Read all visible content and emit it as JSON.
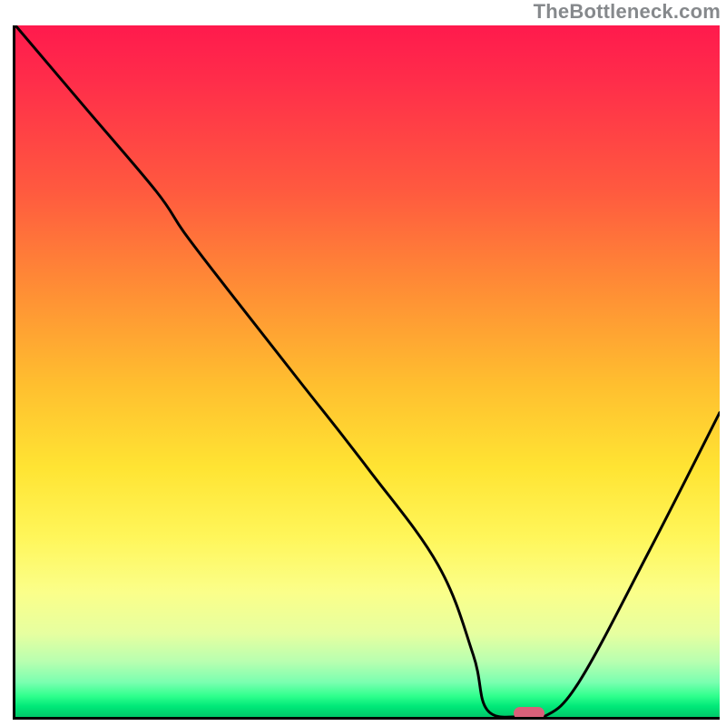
{
  "watermark": "TheBottleneck.com",
  "colors": {
    "axis": "#000000",
    "curve": "#000000",
    "marker": "#d9607a",
    "gradient_top": "#ff1a4d",
    "gradient_bottom": "#00c86a"
  },
  "chart_data": {
    "type": "line",
    "title": "",
    "xlabel": "",
    "ylabel": "",
    "xlim": [
      0,
      100
    ],
    "ylim": [
      0,
      100
    ],
    "grid": false,
    "legend": false,
    "series": [
      {
        "name": "curve",
        "x": [
          0,
          10,
          20,
          24,
          30,
          40,
          50,
          60,
          65,
          67,
          72,
          75,
          80,
          90,
          100
        ],
        "y": [
          100,
          88,
          76,
          70,
          62,
          49,
          36,
          22,
          9,
          1,
          0,
          0,
          5,
          24,
          44
        ]
      }
    ],
    "valley_marker": {
      "x": 73,
      "y": 0
    },
    "annotations": []
  }
}
